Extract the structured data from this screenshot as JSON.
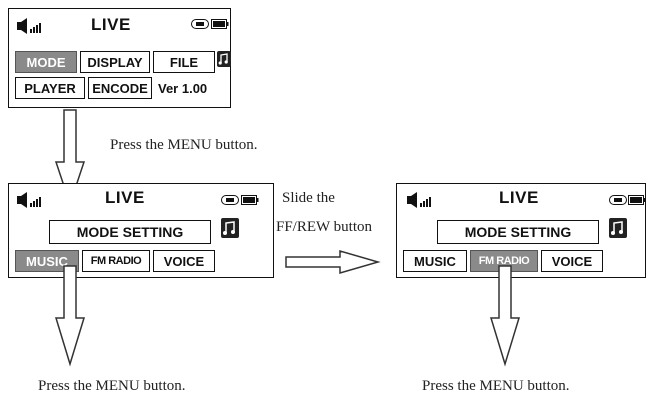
{
  "screens": [
    {
      "title": "LIVE",
      "buttons": [
        "MODE",
        "DISPLAY",
        "FILE",
        "PLAYER",
        "ENCODE"
      ],
      "selected": "MODE",
      "version": "Ver 1.00"
    },
    {
      "title": "LIVE",
      "header": "MODE SETTING",
      "buttons": [
        "MUSIC",
        "FM RADIO",
        "VOICE"
      ],
      "selected": "MUSIC"
    },
    {
      "title": "LIVE",
      "header": "MODE SETTING",
      "buttons": [
        "MUSIC",
        "FM RADIO",
        "VOICE"
      ],
      "selected": "FM RADIO"
    }
  ],
  "captions": {
    "press_menu_top": "Press the MENU button.",
    "slide_line1": "Slide the",
    "slide_line2": "FF/REW button",
    "press_menu_bottom_left": "Press the MENU button.",
    "press_menu_bottom_right": "Press the MENU button."
  },
  "icons": [
    "speaker-volume-icon",
    "ab-repeat-icon",
    "battery-icon",
    "music-note-icon"
  ]
}
